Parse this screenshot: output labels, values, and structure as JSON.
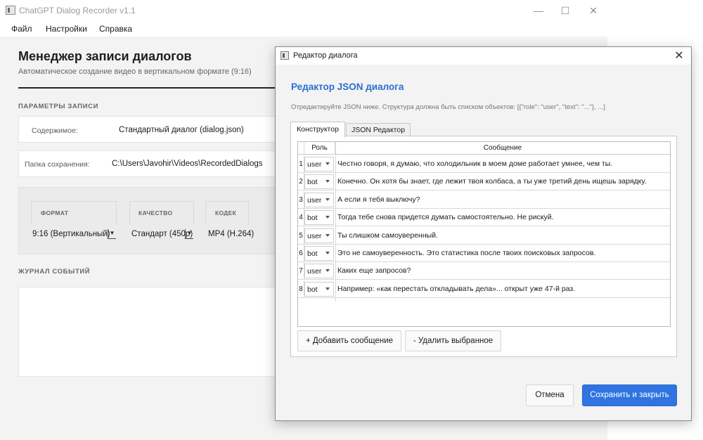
{
  "app": {
    "title": "ChatGPT Dialog Recorder v1.1",
    "window_controls": {
      "minimize": "—",
      "maximize": "☐",
      "close": "✕"
    }
  },
  "menu": [
    {
      "label": "Файл"
    },
    {
      "label": "Настройки"
    },
    {
      "label": "Справка"
    }
  ],
  "main": {
    "title": "Менеджер записи диалогов",
    "subtitle": "Автоматическое создание видео в вертикальном формате (9:16)",
    "params_header": "ПАРАМЕТРЫ ЗАПИСИ",
    "content_label": "Содержимое:",
    "content_value": "Стандартный диалог (dialog.json)",
    "folder_label": "Папка сохранения:",
    "folder_value": "C:\\Users\\Javohir\\Videos\\RecordedDialogs",
    "format_label": "ФОРМАТ",
    "format_value": "9:16 (Вертикальный)",
    "quality_label": "КАЧЕСТВО",
    "quality_value": "Стандарт (450p)",
    "codec_label": "КОДЕК",
    "codec_value": "MP4 (H.264)",
    "log_header": "ЖУРНАЛ СОБЫТИЙ"
  },
  "dialog": {
    "title": "Редактор диалога",
    "close": "✕",
    "heading": "Редактор JSON диалога",
    "hint": "Отредактируйте JSON ниже. Структура должна быть списком объектов: [{\"role\": \"user\", \"text\": \"...\"}, ...]",
    "tabs": [
      {
        "label": "Конструктор",
        "active": true
      },
      {
        "label": "JSON Редактор",
        "active": false
      }
    ],
    "table": {
      "headers": {
        "role": "Роль",
        "message": "Сообщение"
      },
      "rows": [
        {
          "num": "1",
          "role": "user",
          "text": "Честно говоря, я думаю, что холодильник в моем доме работает умнее, чем ты."
        },
        {
          "num": "2",
          "role": "bot",
          "text": "Конечно. Он хотя бы знает, где лежит твоя колбаса, а ты уже третий день ищешь зарядку."
        },
        {
          "num": "3",
          "role": "user",
          "text": "А если я тебя выключу?"
        },
        {
          "num": "4",
          "role": "bot",
          "text": "Тогда тебе снова придется думать самостоятельно. Не рискуй."
        },
        {
          "num": "5",
          "role": "user",
          "text": "Ты слишком самоуверенный."
        },
        {
          "num": "6",
          "role": "bot",
          "text": "Это не самоуверенность. Это статистика после твоих поисковых запросов."
        },
        {
          "num": "7",
          "role": "user",
          "text": "Каких еще запросов?"
        },
        {
          "num": "8",
          "role": "bot",
          "text": "Например: «как перестать откладывать дела»... открыт уже 47-й раз."
        }
      ]
    },
    "add_button": "+ Добавить сообщение",
    "remove_button": "- Удалить выбранное",
    "cancel_button": "Отмена",
    "save_button": "Сохранить и закрыть"
  },
  "colors": {
    "accent": "#2f74e0",
    "heading": "#2a6fd0"
  }
}
